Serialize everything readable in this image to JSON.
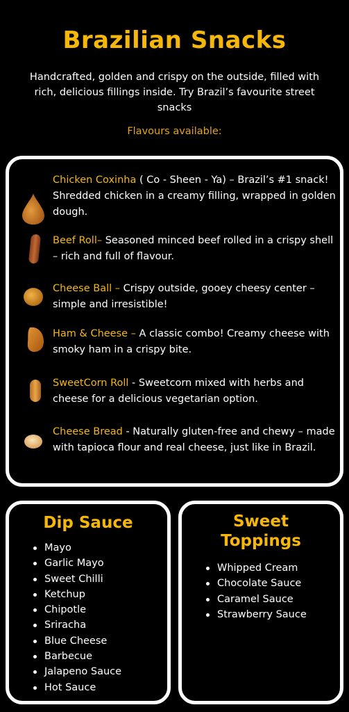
{
  "header": {
    "title": "Brazilian Snacks",
    "subtitle": "Handcrafted, golden and crispy on the outside, filled with rich, delicious fillings inside. Try Brazil’s favourite street snacks",
    "flavours_label": "Flavours available:"
  },
  "menu": {
    "items": [
      {
        "name": "Chicken Coxinha",
        "description": " ( Co - Sheen - Ya) – Brazil’s #1 snack! Shredded chicken in a creamy filling, wrapped in golden dough.",
        "icon": "coxinha-icon"
      },
      {
        "name": "Beef Roll–",
        "description": " Seasoned minced beef rolled in a crispy shell – rich and full of flavour.",
        "icon": "beef-roll-icon"
      },
      {
        "name": "Cheese Ball –",
        "description": " Crispy outside, gooey cheesy center – simple and irresistible!",
        "icon": "cheese-ball-icon"
      },
      {
        "name": "Ham & Cheese –",
        "description": " A classic combo! Creamy cheese with smoky ham in a crispy bite.",
        "icon": "ham-cheese-icon"
      },
      {
        "name": "SweetCorn Roll",
        "description": " - Sweetcorn mixed with herbs and cheese for a delicious vegetarian option.",
        "icon": "sweetcorn-roll-icon"
      },
      {
        "name": "Cheese Bread",
        "description": " - Naturally gluten-free and chewy – made with tapioca flour and real cheese, just like in Brazil.",
        "icon": "cheese-bread-icon"
      }
    ]
  },
  "dip_sauce": {
    "title": "Dip Sauce",
    "items": [
      "Mayo",
      "Garlic Mayo",
      "Sweet Chilli",
      "Ketchup",
      "Chipotle",
      "Sriracha",
      "Blue Cheese",
      "Barbecue",
      "Jalapeno Sauce",
      "Hot Sauce"
    ]
  },
  "sweet_toppings": {
    "title_line1": "Sweet",
    "title_line2": "Toppings",
    "items": [
      "Whipped Cream",
      "Chocolate Sauce",
      "Caramel Sauce",
      "Strawberry Sauce"
    ]
  },
  "colors": {
    "accent": "#f5b70c",
    "background": "#000000",
    "text": "#ffffff"
  }
}
